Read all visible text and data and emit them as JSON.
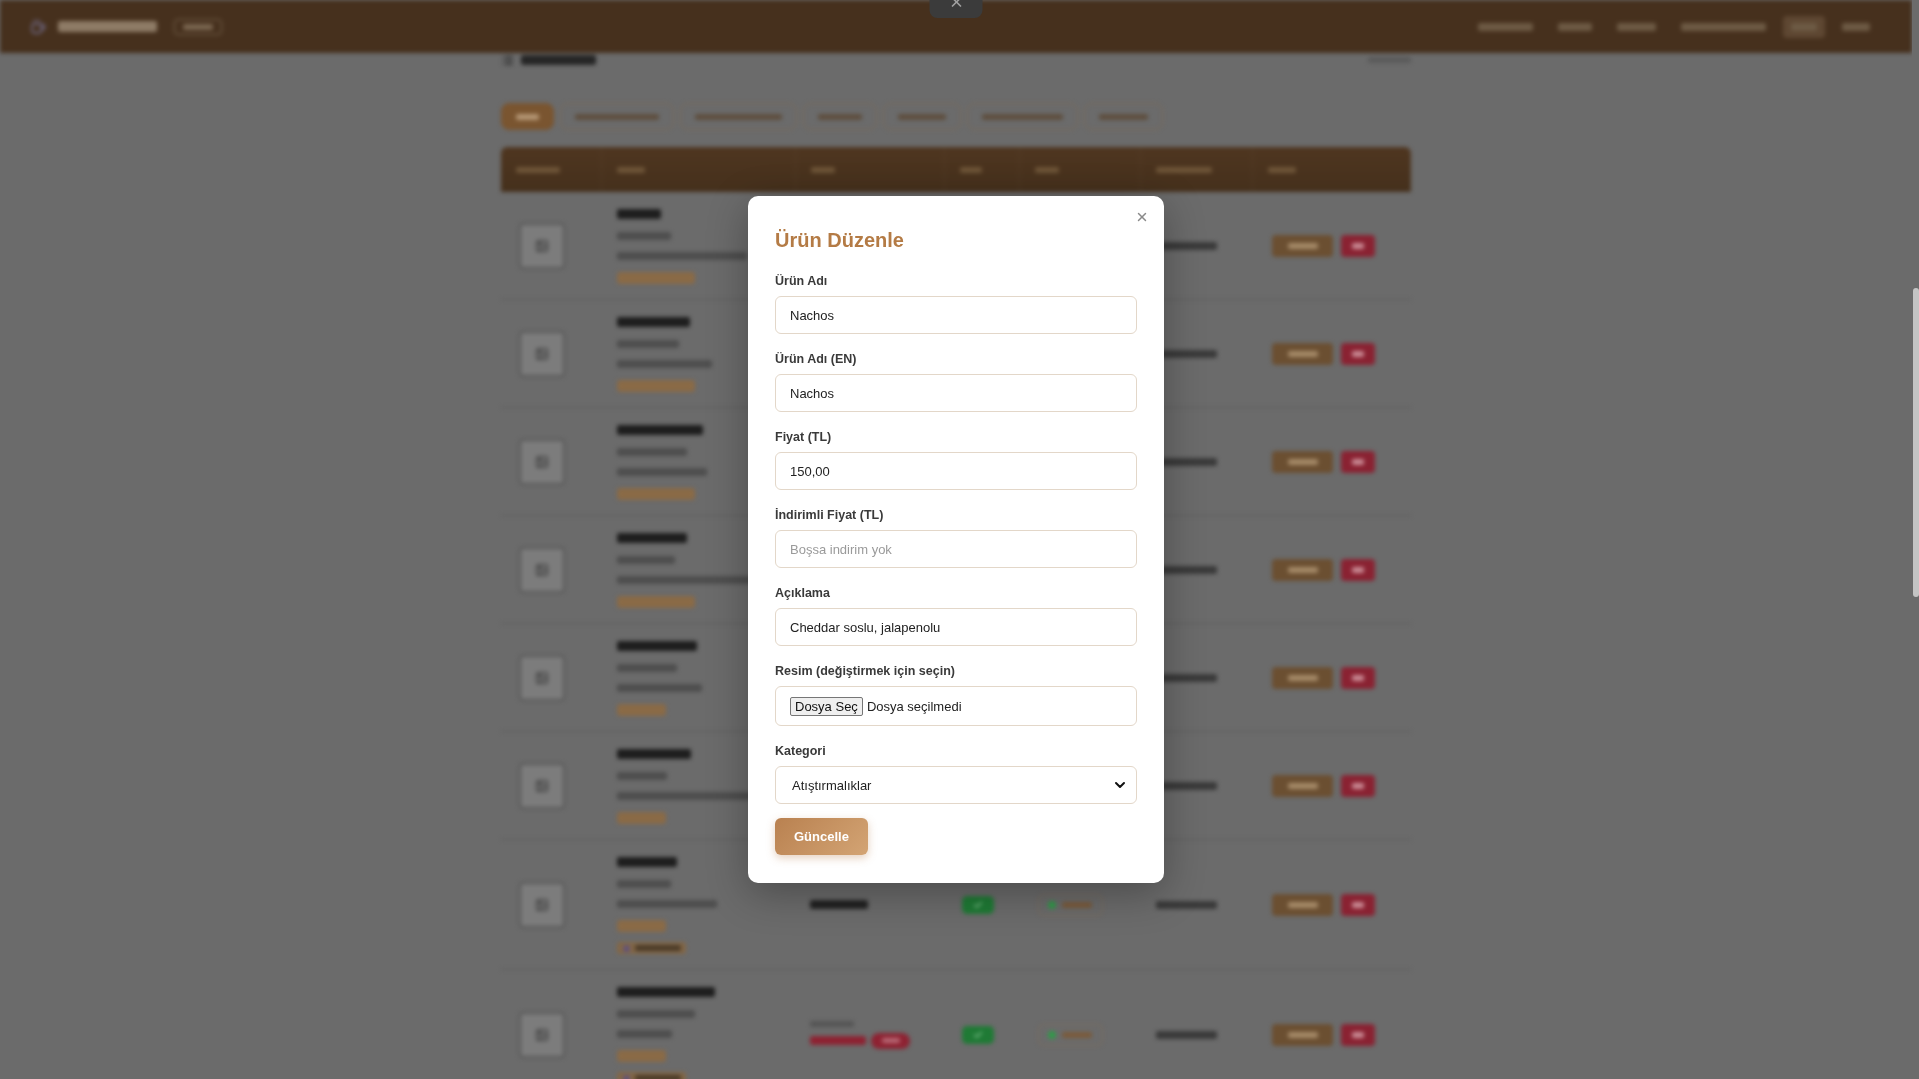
{
  "header": {
    "nav": [
      {
        "selected": false
      },
      {
        "selected": false
      },
      {
        "selected": false
      },
      {
        "selected": false
      },
      {
        "selected": true
      },
      {
        "selected": false
      }
    ]
  },
  "product_list": {
    "filters": [
      {
        "selected": true
      },
      {
        "selected": false
      },
      {
        "selected": false
      },
      {
        "selected": false
      },
      {
        "selected": false
      },
      {
        "selected": false
      },
      {
        "selected": false
      }
    ]
  },
  "products": [
    {
      "icon_tag": false
    },
    {
      "icon_tag": false
    },
    {
      "icon_tag": false
    },
    {
      "icon_tag": false
    },
    {
      "icon_tag": false
    },
    {
      "icon_tag": false
    },
    {
      "icon_tag": true,
      "active": true,
      "discounted": false
    },
    {
      "icon_tag": true,
      "active": true,
      "discounted": true
    }
  ],
  "modal": {
    "title": "Ürün Düzenle",
    "fields": [
      {
        "kind": "text",
        "label": "Ürün Adı",
        "value": "Nachos"
      },
      {
        "kind": "text",
        "label": "Ürün Adı (EN)",
        "value": "Nachos"
      },
      {
        "kind": "text",
        "label": "Fiyat (TL)",
        "value": "150,00"
      },
      {
        "kind": "text",
        "label": "İndirimli Fiyat (TL)",
        "placeholder": "Boşsa indirim yok"
      },
      {
        "kind": "text",
        "label": "Açıklama",
        "value": "Cheddar soslu, jalapenolu"
      },
      {
        "kind": "file",
        "label": "Resim (değiştirmek için seçin)",
        "button": "Dosya Seç",
        "status": "Dosya seçilmedi"
      },
      {
        "kind": "select",
        "label": "Kategori",
        "value": "Atıştırmalıklar"
      }
    ],
    "submit": "Güncelle"
  }
}
